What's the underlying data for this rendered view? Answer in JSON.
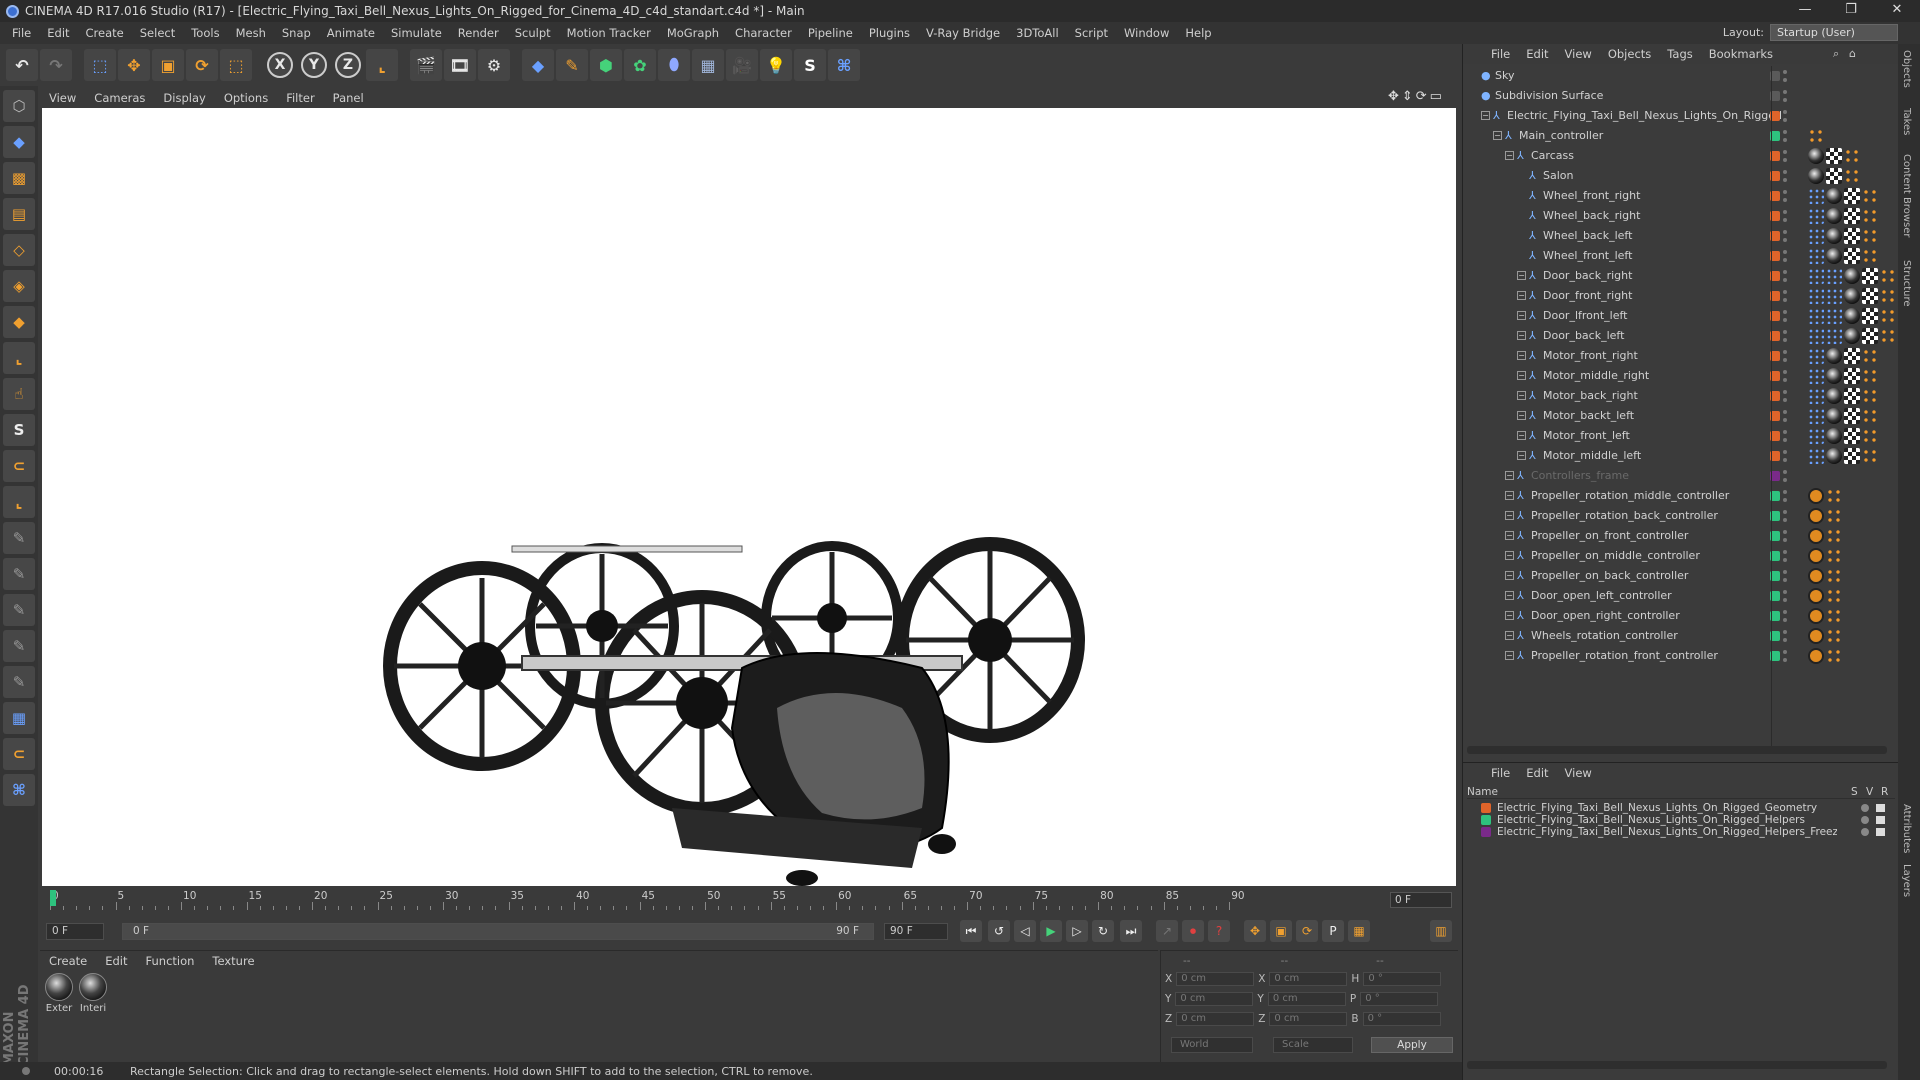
{
  "window": {
    "title": "CINEMA 4D R17.016 Studio (R17) - [Electric_Flying_Taxi_Bell_Nexus_Lights_On_Rigged_for_Cinema_4D_c4d_standart.c4d *] - Main",
    "controls": [
      "—",
      "❐",
      "✕"
    ]
  },
  "menubar": {
    "items": [
      "File",
      "Edit",
      "Create",
      "Select",
      "Tools",
      "Mesh",
      "Snap",
      "Animate",
      "Simulate",
      "Render",
      "Sculpt",
      "Motion Tracker",
      "MoGraph",
      "Character",
      "Pipeline",
      "Plugins",
      "V-Ray Bridge",
      "3DToAll",
      "Script",
      "Window",
      "Help"
    ],
    "layout_label": "Layout:",
    "layout_value": "Startup (User)"
  },
  "toolbar": {
    "undo_icon": "undo-icon",
    "axis_labels": [
      "X",
      "Y",
      "Z"
    ]
  },
  "viewport": {
    "menu": [
      "View",
      "Cameras",
      "Display",
      "Options",
      "Filter",
      "Panel"
    ]
  },
  "timeline": {
    "ticks": [
      "0",
      "5",
      "10",
      "15",
      "20",
      "25",
      "30",
      "35",
      "40",
      "45",
      "50",
      "55",
      "60",
      "65",
      "70",
      "75",
      "80",
      "85",
      "90"
    ],
    "current_frame": "0 F"
  },
  "transport": {
    "start_field": "0 F",
    "slider_start": "0 F",
    "slider_end": "90 F",
    "end_field": "90 F"
  },
  "material_manager": {
    "menu": [
      "Create",
      "Edit",
      "Function",
      "Texture"
    ],
    "materials": [
      "Exter",
      "Interi"
    ]
  },
  "coordinates": {
    "header": [
      "--",
      "--",
      "--"
    ],
    "rows": [
      {
        "a": "X",
        "av": "0 cm",
        "b": "X",
        "bv": "0 cm",
        "c": "H",
        "cv": "0 °"
      },
      {
        "a": "Y",
        "av": "0 cm",
        "b": "Y",
        "bv": "0 cm",
        "c": "P",
        "cv": "0 °"
      },
      {
        "a": "Z",
        "av": "0 cm",
        "b": "Z",
        "bv": "0 cm",
        "c": "B",
        "cv": "0 °"
      }
    ],
    "world": "World",
    "scale": "Scale",
    "apply": "Apply"
  },
  "status": {
    "time": "00:00:16",
    "message": "Rectangle Selection: Click and drag to rectangle-select elements. Hold down SHIFT to add to the selection, CTRL to remove."
  },
  "object_manager": {
    "menu": [
      "File",
      "Edit",
      "View",
      "Objects",
      "Tags",
      "Bookmarks"
    ],
    "objects": [
      {
        "name": "Sky",
        "level": 0,
        "color": "#5a5a5a",
        "tags": []
      },
      {
        "name": "Subdivision Surface",
        "level": 0,
        "color": "#5a5a5a",
        "tags": []
      },
      {
        "name": "Electric_Flying_Taxi_Bell_Nexus_Lights_On_Rigged",
        "level": 1,
        "color": "#e0642a",
        "tags": []
      },
      {
        "name": "Main_controller",
        "level": 2,
        "color": "#2ec27e",
        "tags": [
          "ori"
        ]
      },
      {
        "name": "Carcass",
        "level": 3,
        "color": "#e0642a",
        "tags": [
          "ball",
          "chk",
          "ori"
        ]
      },
      {
        "name": "Salon",
        "level": 4,
        "color": "#e0642a",
        "tags": [
          "ball",
          "chk",
          "ori"
        ]
      },
      {
        "name": "Wheel_front_right",
        "level": 4,
        "color": "#e0642a",
        "tags": [
          "blu",
          "ball",
          "chk",
          "ori"
        ]
      },
      {
        "name": "Wheel_back_right",
        "level": 4,
        "color": "#e0642a",
        "tags": [
          "blu",
          "ball",
          "chk",
          "ori"
        ]
      },
      {
        "name": "Wheel_back_left",
        "level": 4,
        "color": "#e0642a",
        "tags": [
          "blu",
          "ball",
          "chk",
          "ori"
        ]
      },
      {
        "name": "Wheel_front_left",
        "level": 4,
        "color": "#e0642a",
        "tags": [
          "blu",
          "ball",
          "chk",
          "ori"
        ]
      },
      {
        "name": "Door_back_right",
        "level": 4,
        "color": "#e0642a",
        "tags": [
          "blu",
          "blu",
          "ball",
          "chk",
          "ori"
        ]
      },
      {
        "name": "Door_front_right",
        "level": 4,
        "color": "#e0642a",
        "tags": [
          "blu",
          "blu",
          "ball",
          "chk",
          "ori"
        ]
      },
      {
        "name": "Door_lfront_left",
        "level": 4,
        "color": "#e0642a",
        "tags": [
          "blu",
          "blu",
          "ball",
          "chk",
          "ori"
        ]
      },
      {
        "name": "Door_back_left",
        "level": 4,
        "color": "#e0642a",
        "tags": [
          "blu",
          "blu",
          "ball",
          "chk",
          "ori"
        ]
      },
      {
        "name": "Motor_front_right",
        "level": 4,
        "color": "#e0642a",
        "tags": [
          "blu",
          "ball",
          "chk",
          "ori"
        ]
      },
      {
        "name": "Motor_middle_right",
        "level": 4,
        "color": "#e0642a",
        "tags": [
          "blu",
          "ball",
          "chk",
          "ori"
        ]
      },
      {
        "name": "Motor_back_right",
        "level": 4,
        "color": "#e0642a",
        "tags": [
          "blu",
          "ball",
          "chk",
          "ori"
        ]
      },
      {
        "name": "Motor_backt_left",
        "level": 4,
        "color": "#e0642a",
        "tags": [
          "blu",
          "ball",
          "chk",
          "ori"
        ]
      },
      {
        "name": "Motor_front_left",
        "level": 4,
        "color": "#e0642a",
        "tags": [
          "blu",
          "ball",
          "chk",
          "ori"
        ]
      },
      {
        "name": "Motor_middle_left",
        "level": 4,
        "color": "#e0642a",
        "tags": [
          "blu",
          "ball",
          "chk",
          "ori"
        ]
      },
      {
        "name": "Controllers_frame",
        "level": 3,
        "color": "#7a2a8a",
        "tags": []
      },
      {
        "name": "Propeller_rotation_middle_controller",
        "level": 3,
        "color": "#2ec27e",
        "tags": [
          "xp",
          "ori"
        ]
      },
      {
        "name": "Propeller_rotation_back_controller",
        "level": 3,
        "color": "#2ec27e",
        "tags": [
          "xp",
          "ori"
        ]
      },
      {
        "name": "Propeller_on_front_controller",
        "level": 3,
        "color": "#2ec27e",
        "tags": [
          "xp",
          "ori"
        ]
      },
      {
        "name": "Propeller_on_middle_controller",
        "level": 3,
        "color": "#2ec27e",
        "tags": [
          "xp",
          "ori"
        ]
      },
      {
        "name": "Propeller_on_back_controller",
        "level": 3,
        "color": "#2ec27e",
        "tags": [
          "xp",
          "ori"
        ]
      },
      {
        "name": "Door_open_left_controller",
        "level": 3,
        "color": "#2ec27e",
        "tags": [
          "xp",
          "ori"
        ]
      },
      {
        "name": "Door_open_right_controller",
        "level": 3,
        "color": "#2ec27e",
        "tags": [
          "xp",
          "ori"
        ]
      },
      {
        "name": "Wheels_rotation_controller",
        "level": 3,
        "color": "#2ec27e",
        "tags": [
          "xp",
          "ori"
        ]
      },
      {
        "name": "Propeller_rotation_front_controller",
        "level": 3,
        "color": "#2ec27e",
        "tags": [
          "xp",
          "ori"
        ]
      }
    ]
  },
  "layer_manager": {
    "menu": [
      "File",
      "Edit",
      "View"
    ],
    "header": {
      "name": "Name",
      "s": "S",
      "v": "V",
      "r": "R"
    },
    "layers": [
      {
        "name": "Electric_Flying_Taxi_Bell_Nexus_Lights_On_Rigged_Geometry",
        "color": "#e0642a"
      },
      {
        "name": "Electric_Flying_Taxi_Bell_Nexus_Lights_On_Rigged_Helpers",
        "color": "#2ec27e"
      },
      {
        "name": "Electric_Flying_Taxi_Bell_Nexus_Lights_On_Rigged_Helpers_Freeze",
        "color": "#7a2a8a"
      }
    ]
  },
  "side_tabs": [
    "Objects",
    "Takes",
    "Content Browser",
    "Structure",
    "Attributes",
    "Layers"
  ],
  "brand": "MAXON CINEMA 4D"
}
